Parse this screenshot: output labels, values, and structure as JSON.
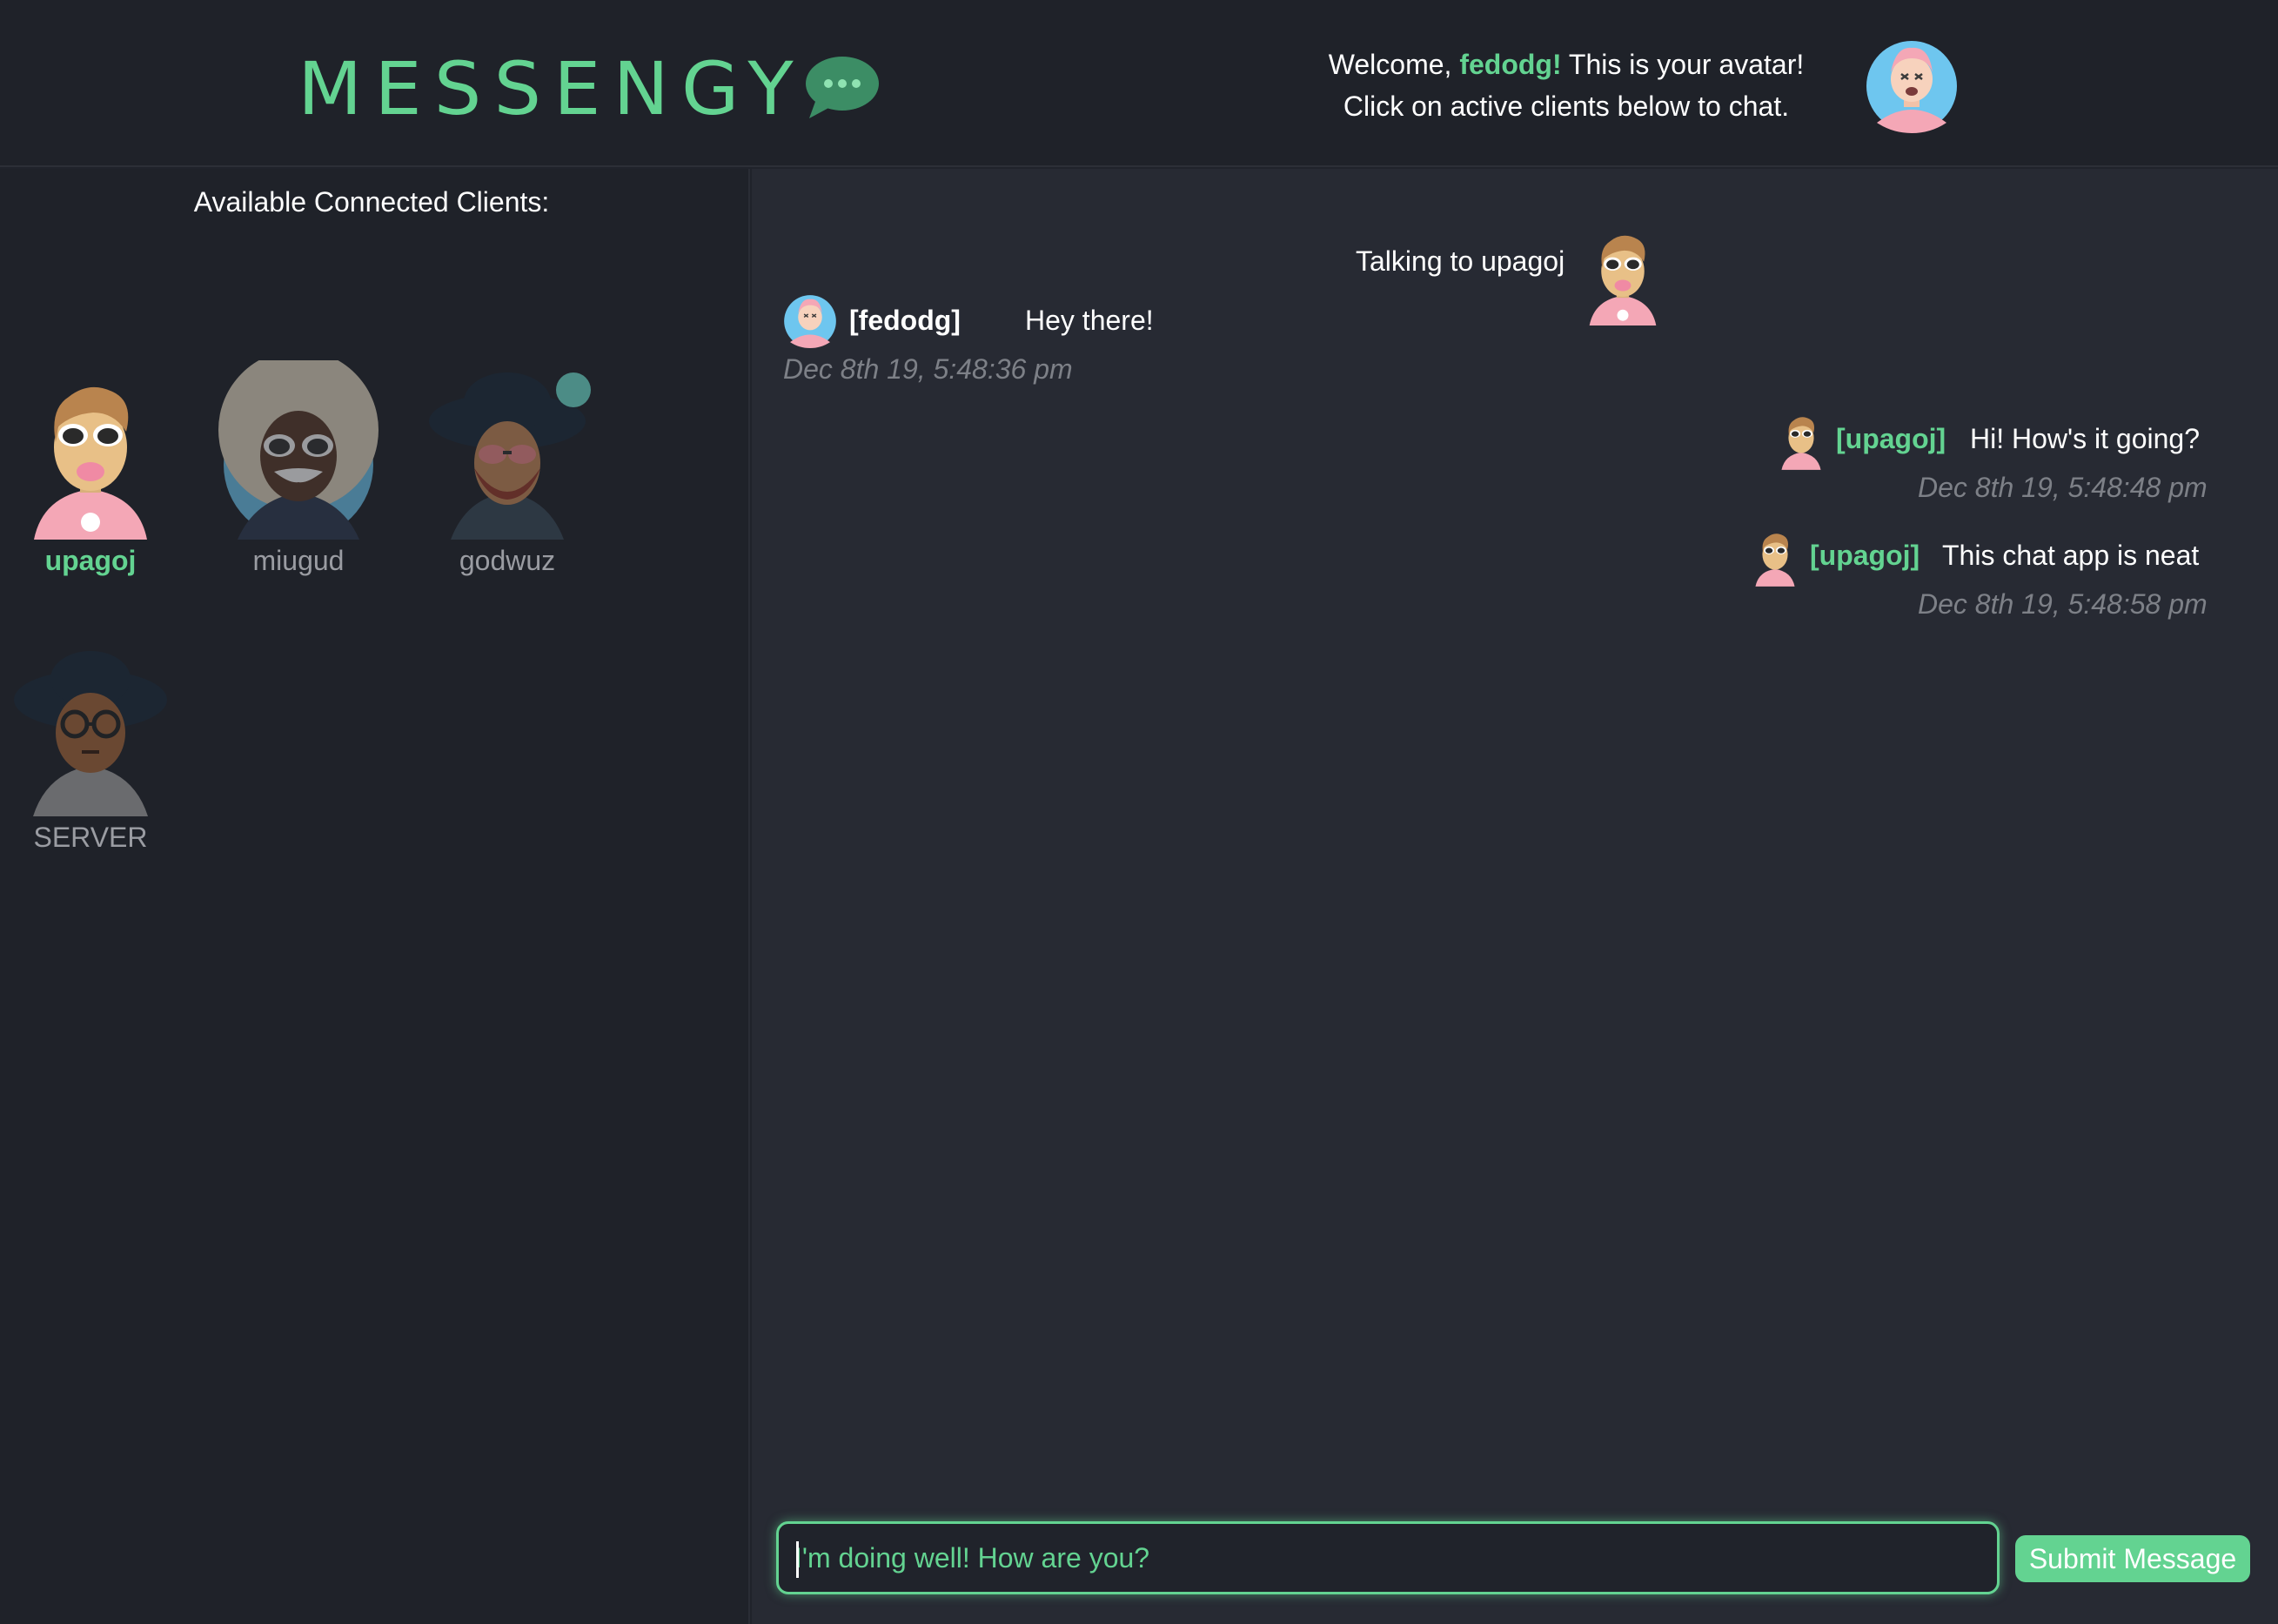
{
  "app": {
    "logo_text": "MESSENGY",
    "welcome_prefix": "Welcome,",
    "username": "fedodg!",
    "welcome_suffix": "This is your avatar!",
    "welcome_line2": "Click on active clients below to chat."
  },
  "sidebar": {
    "title": "Available Connected Clients:",
    "clients": [
      {
        "name": "upagoj",
        "active": true
      },
      {
        "name": "miugud",
        "active": false
      },
      {
        "name": "godwuz",
        "active": false,
        "online_dot": true
      },
      {
        "name": "SERVER",
        "active": false
      }
    ]
  },
  "chat": {
    "talking_label": "Talking to upagoj",
    "messages": [
      {
        "author": "[fedodg]",
        "text": "Hey there!",
        "time": "Dec 8th 19, 5:48:36 pm",
        "self": true
      },
      {
        "author": "[upagoj]",
        "text": "Hi! How's it going?",
        "time": "Dec 8th 19, 5:48:48 pm",
        "self": false
      },
      {
        "author": "[upagoj]",
        "text": "This chat app is neat",
        "time": "Dec 8th 19, 5:48:58 pm",
        "self": false
      }
    ],
    "input_value": "I'm doing well! How are you?",
    "submit_label": "Submit Message"
  },
  "colors": {
    "accent": "#63d391",
    "background": "#20232b",
    "chat_background": "#272a33",
    "timestamp": "#7d8087"
  },
  "icons": [
    "chat-bubble-icon",
    "user-avatar-icon"
  ]
}
